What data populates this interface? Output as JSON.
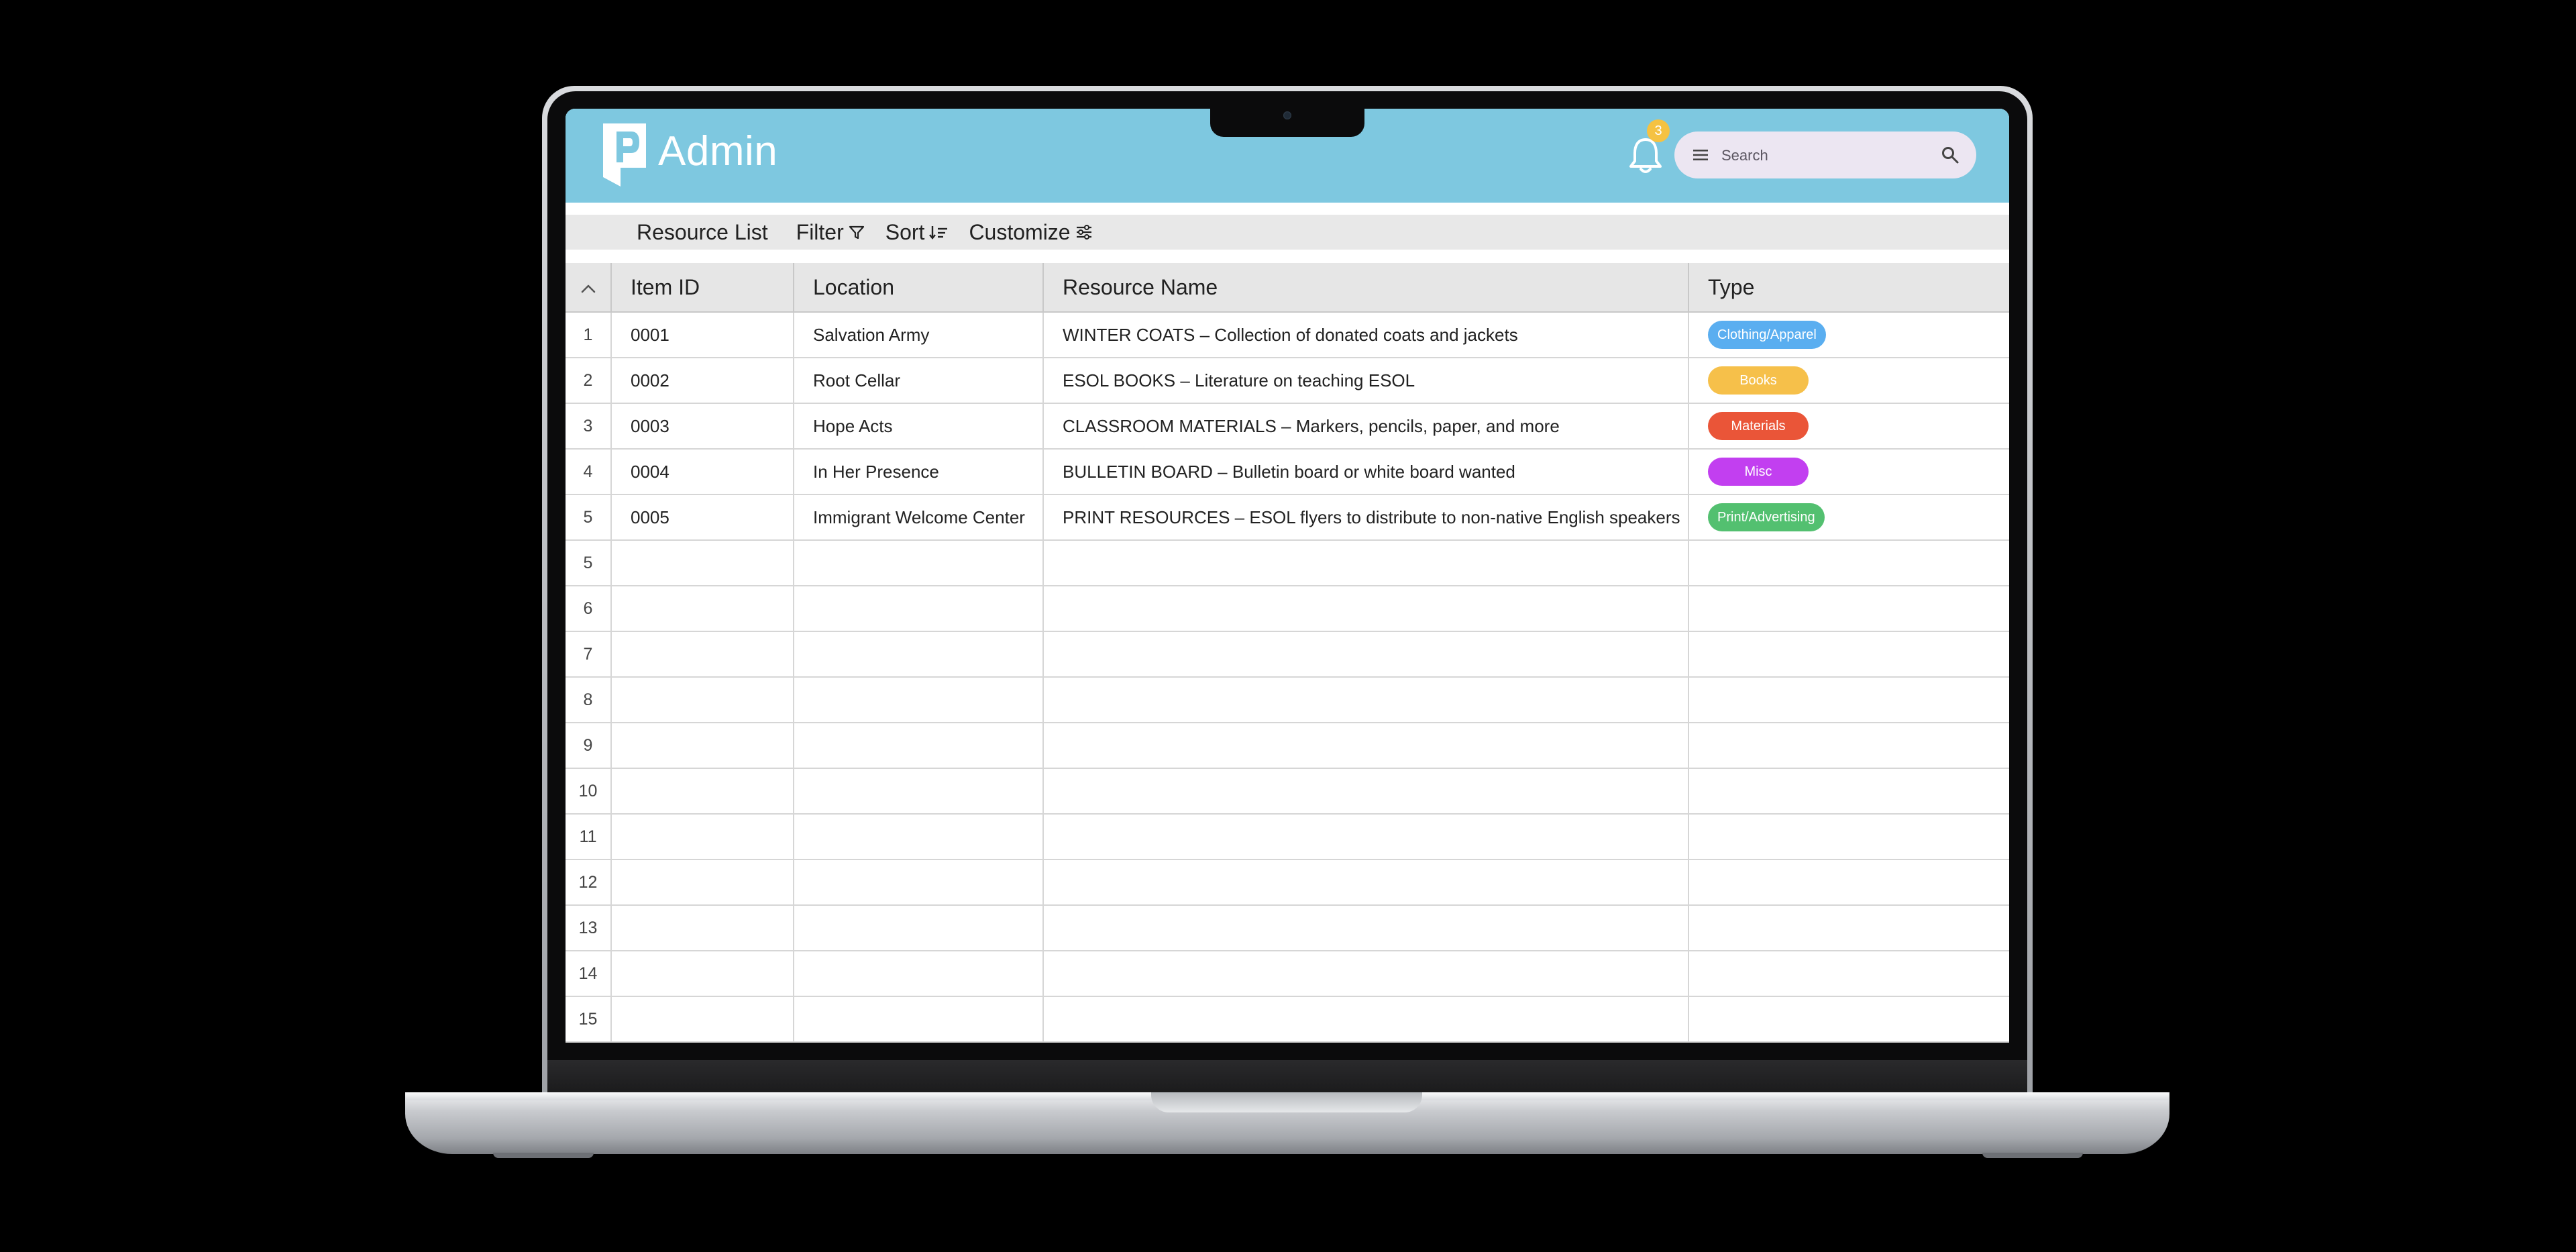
{
  "app": {
    "title": "Admin",
    "notifications_count": "3"
  },
  "search": {
    "placeholder": "Search"
  },
  "toolbar": {
    "resource_list": "Resource List",
    "filter": "Filter",
    "sort": "Sort",
    "customize": "Customize"
  },
  "table": {
    "columns": [
      "Item ID",
      "Location",
      "Resource Name",
      "Type"
    ],
    "rows": [
      {
        "index": "1",
        "item_id": "0001",
        "location": "Salvation Army",
        "resource_name": "WINTER COATS – Collection of donated coats and jackets",
        "type": "Clothing/Apparel",
        "type_color": "#5aaef0"
      },
      {
        "index": "2",
        "item_id": "0002",
        "location": "Root Cellar",
        "resource_name": "ESOL BOOKS – Literature on teaching ESOL",
        "type": "Books",
        "type_color": "#f6c04a"
      },
      {
        "index": "3",
        "item_id": "0003",
        "location": "Hope Acts",
        "resource_name": "CLASSROOM MATERIALS – Markers, pencils, paper, and more",
        "type": "Materials",
        "type_color": "#ea5538"
      },
      {
        "index": "4",
        "item_id": "0004",
        "location": "In Her Presence",
        "resource_name": "BULLETIN BOARD – Bulletin board or white board wanted",
        "type": "Misc",
        "type_color": "#c23ff0"
      },
      {
        "index": "5",
        "item_id": "0005",
        "location": "Immigrant Welcome Center",
        "resource_name": "PRINT RESOURCES – ESOL flyers to distribute to non-native English speakers",
        "type": "Print/Advertising",
        "type_color": "#53c070"
      }
    ],
    "empty_row_indices": [
      "5",
      "6",
      "7",
      "8",
      "9",
      "10",
      "11",
      "12",
      "13",
      "14",
      "15"
    ]
  },
  "colors": {
    "header_bg": "#7ec8e0",
    "toolbar_bg": "#e8e8e8",
    "badge": "#f5c242"
  },
  "icons": [
    "logo-icon",
    "bell-icon",
    "menu-icon",
    "search-icon",
    "filter-icon",
    "sort-icon",
    "customize-icon",
    "chevron-up-icon"
  ]
}
